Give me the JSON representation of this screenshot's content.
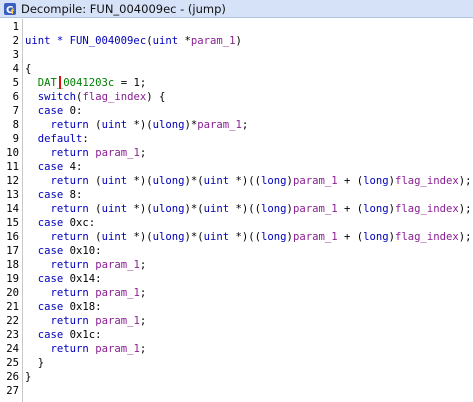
{
  "window": {
    "title": "Decompile: FUN_004009ec -  (jump)",
    "icon": "decompile-icon"
  },
  "lines": [
    {
      "num": "1",
      "tokens": []
    },
    {
      "num": "2",
      "tokens": [
        {
          "t": "uint * ",
          "c": "ty"
        },
        {
          "t": "FUN_004009ec",
          "c": "fn"
        },
        {
          "t": "(",
          "c": ""
        },
        {
          "t": "uint",
          "c": "ty"
        },
        {
          "t": " *",
          "c": ""
        },
        {
          "t": "param_1",
          "c": "var"
        },
        {
          "t": ")",
          "c": ""
        }
      ]
    },
    {
      "num": "3",
      "tokens": []
    },
    {
      "num": "4",
      "tokens": [
        {
          "t": "{",
          "c": ""
        }
      ]
    },
    {
      "num": "5",
      "tokens": [
        {
          "t": "  ",
          "c": ""
        },
        {
          "t": "DAT_0041203c",
          "c": "glob"
        },
        {
          "t": " = 1;",
          "c": ""
        }
      ]
    },
    {
      "num": "6",
      "tokens": [
        {
          "t": "  ",
          "c": ""
        },
        {
          "t": "switch",
          "c": "kw"
        },
        {
          "t": "(",
          "c": ""
        },
        {
          "t": "flag_index",
          "c": "var"
        },
        {
          "t": ") {",
          "c": ""
        }
      ]
    },
    {
      "num": "7",
      "tokens": [
        {
          "t": "  ",
          "c": ""
        },
        {
          "t": "case",
          "c": "kw"
        },
        {
          "t": " 0:",
          "c": ""
        }
      ]
    },
    {
      "num": "8",
      "tokens": [
        {
          "t": "    ",
          "c": ""
        },
        {
          "t": "return",
          "c": "kw"
        },
        {
          "t": " (",
          "c": ""
        },
        {
          "t": "uint",
          "c": "ty"
        },
        {
          "t": " *)(",
          "c": ""
        },
        {
          "t": "ulong",
          "c": "ty"
        },
        {
          "t": ")*",
          "c": ""
        },
        {
          "t": "param_1",
          "c": "var"
        },
        {
          "t": ";",
          "c": ""
        }
      ]
    },
    {
      "num": "9",
      "tokens": [
        {
          "t": "  ",
          "c": ""
        },
        {
          "t": "default",
          "c": "kw"
        },
        {
          "t": ":",
          "c": ""
        }
      ]
    },
    {
      "num": "10",
      "tokens": [
        {
          "t": "    ",
          "c": ""
        },
        {
          "t": "return",
          "c": "kw"
        },
        {
          "t": " ",
          "c": ""
        },
        {
          "t": "param_1",
          "c": "var"
        },
        {
          "t": ";",
          "c": ""
        }
      ]
    },
    {
      "num": "11",
      "tokens": [
        {
          "t": "  ",
          "c": ""
        },
        {
          "t": "case",
          "c": "kw"
        },
        {
          "t": " 4:",
          "c": ""
        }
      ]
    },
    {
      "num": "12",
      "tokens": [
        {
          "t": "    ",
          "c": ""
        },
        {
          "t": "return",
          "c": "kw"
        },
        {
          "t": " (",
          "c": ""
        },
        {
          "t": "uint",
          "c": "ty"
        },
        {
          "t": " *)(",
          "c": ""
        },
        {
          "t": "ulong",
          "c": "ty"
        },
        {
          "t": ")*(",
          "c": ""
        },
        {
          "t": "uint",
          "c": "ty"
        },
        {
          "t": " *)((",
          "c": ""
        },
        {
          "t": "long",
          "c": "ty"
        },
        {
          "t": ")",
          "c": ""
        },
        {
          "t": "param_1",
          "c": "var"
        },
        {
          "t": " + (",
          "c": ""
        },
        {
          "t": "long",
          "c": "ty"
        },
        {
          "t": ")",
          "c": ""
        },
        {
          "t": "flag_index",
          "c": "var"
        },
        {
          "t": ");",
          "c": ""
        }
      ]
    },
    {
      "num": "13",
      "tokens": [
        {
          "t": "  ",
          "c": ""
        },
        {
          "t": "case",
          "c": "kw"
        },
        {
          "t": " 8:",
          "c": ""
        }
      ]
    },
    {
      "num": "14",
      "tokens": [
        {
          "t": "    ",
          "c": ""
        },
        {
          "t": "return",
          "c": "kw"
        },
        {
          "t": " (",
          "c": ""
        },
        {
          "t": "uint",
          "c": "ty"
        },
        {
          "t": " *)(",
          "c": ""
        },
        {
          "t": "ulong",
          "c": "ty"
        },
        {
          "t": ")*(",
          "c": ""
        },
        {
          "t": "uint",
          "c": "ty"
        },
        {
          "t": " *)((",
          "c": ""
        },
        {
          "t": "long",
          "c": "ty"
        },
        {
          "t": ")",
          "c": ""
        },
        {
          "t": "param_1",
          "c": "var"
        },
        {
          "t": " + (",
          "c": ""
        },
        {
          "t": "long",
          "c": "ty"
        },
        {
          "t": ")",
          "c": ""
        },
        {
          "t": "flag_index",
          "c": "var"
        },
        {
          "t": ");",
          "c": ""
        }
      ]
    },
    {
      "num": "15",
      "tokens": [
        {
          "t": "  ",
          "c": ""
        },
        {
          "t": "case",
          "c": "kw"
        },
        {
          "t": " 0xc:",
          "c": ""
        }
      ]
    },
    {
      "num": "16",
      "tokens": [
        {
          "t": "    ",
          "c": ""
        },
        {
          "t": "return",
          "c": "kw"
        },
        {
          "t": " (",
          "c": ""
        },
        {
          "t": "uint",
          "c": "ty"
        },
        {
          "t": " *)(",
          "c": ""
        },
        {
          "t": "ulong",
          "c": "ty"
        },
        {
          "t": ")*(",
          "c": ""
        },
        {
          "t": "uint",
          "c": "ty"
        },
        {
          "t": " *)((",
          "c": ""
        },
        {
          "t": "long",
          "c": "ty"
        },
        {
          "t": ")",
          "c": ""
        },
        {
          "t": "param_1",
          "c": "var"
        },
        {
          "t": " + (",
          "c": ""
        },
        {
          "t": "long",
          "c": "ty"
        },
        {
          "t": ")",
          "c": ""
        },
        {
          "t": "flag_index",
          "c": "var"
        },
        {
          "t": ");",
          "c": ""
        }
      ]
    },
    {
      "num": "17",
      "tokens": [
        {
          "t": "  ",
          "c": ""
        },
        {
          "t": "case",
          "c": "kw"
        },
        {
          "t": " 0x10:",
          "c": ""
        }
      ]
    },
    {
      "num": "18",
      "tokens": [
        {
          "t": "    ",
          "c": ""
        },
        {
          "t": "return",
          "c": "kw"
        },
        {
          "t": " ",
          "c": ""
        },
        {
          "t": "param_1",
          "c": "var"
        },
        {
          "t": ";",
          "c": ""
        }
      ]
    },
    {
      "num": "19",
      "tokens": [
        {
          "t": "  ",
          "c": ""
        },
        {
          "t": "case",
          "c": "kw"
        },
        {
          "t": " 0x14:",
          "c": ""
        }
      ]
    },
    {
      "num": "20",
      "tokens": [
        {
          "t": "    ",
          "c": ""
        },
        {
          "t": "return",
          "c": "kw"
        },
        {
          "t": " ",
          "c": ""
        },
        {
          "t": "param_1",
          "c": "var"
        },
        {
          "t": ";",
          "c": ""
        }
      ]
    },
    {
      "num": "21",
      "tokens": [
        {
          "t": "  ",
          "c": ""
        },
        {
          "t": "case",
          "c": "kw"
        },
        {
          "t": " 0x18:",
          "c": ""
        }
      ]
    },
    {
      "num": "22",
      "tokens": [
        {
          "t": "    ",
          "c": ""
        },
        {
          "t": "return",
          "c": "kw"
        },
        {
          "t": " ",
          "c": ""
        },
        {
          "t": "param_1",
          "c": "var"
        },
        {
          "t": ";",
          "c": ""
        }
      ]
    },
    {
      "num": "23",
      "tokens": [
        {
          "t": "  ",
          "c": ""
        },
        {
          "t": "case",
          "c": "kw"
        },
        {
          "t": " 0x1c:",
          "c": ""
        }
      ]
    },
    {
      "num": "24",
      "tokens": [
        {
          "t": "    ",
          "c": ""
        },
        {
          "t": "return",
          "c": "kw"
        },
        {
          "t": " ",
          "c": ""
        },
        {
          "t": "param_1",
          "c": "var"
        },
        {
          "t": ";",
          "c": ""
        }
      ]
    },
    {
      "num": "25",
      "tokens": [
        {
          "t": "  }",
          "c": ""
        }
      ]
    },
    {
      "num": "26",
      "tokens": [
        {
          "t": "}",
          "c": ""
        }
      ]
    },
    {
      "num": "27",
      "tokens": []
    }
  ],
  "colors": {
    "keyword": "#0000bb",
    "variable": "#8a2094",
    "global": "#008000",
    "titlebar": "#d6e2f7",
    "cursor": "#e01010"
  }
}
